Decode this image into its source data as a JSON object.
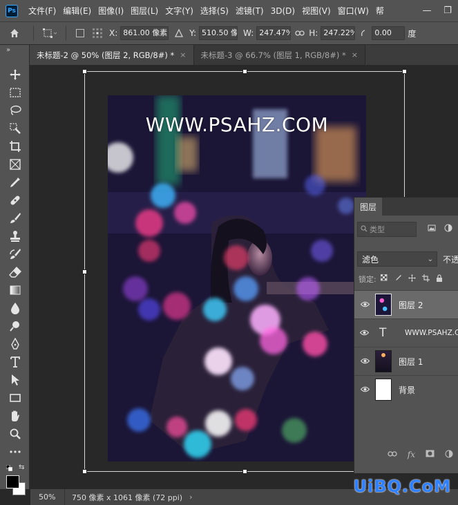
{
  "menubar": {
    "logo": "Ps",
    "items": [
      "文件(F)",
      "编辑(E)",
      "图像(I)",
      "图层(L)",
      "文字(Y)",
      "选择(S)",
      "滤镜(T)",
      "3D(D)",
      "视图(V)",
      "窗口(W)",
      "帮"
    ],
    "minimize": "—",
    "restore": "❐"
  },
  "options": {
    "x_label": "X:",
    "x_value": "861.00 像素",
    "y_label": "Y:",
    "y_value": "510.50 像",
    "w_label": "W:",
    "w_value": "247.47%",
    "h_label": "H:",
    "h_value": "247.22%",
    "angle_value": "0.00",
    "angle_unit": "度"
  },
  "tabs": [
    {
      "label": "未标题-2 @ 50% (图层 2, RGB/8#) *",
      "close": "×"
    },
    {
      "label": "未标题-3 @ 66.7% (图层 1, RGB/8#) *",
      "close": "×"
    }
  ],
  "toolbar": {
    "collapse": "»",
    "tools": [
      "move-tool",
      "marquee-tool",
      "lasso-tool",
      "quick-select-tool",
      "crop-tool",
      "frame-tool",
      "eyedropper-tool",
      "healing-tool",
      "brush-tool",
      "stamp-tool",
      "history-brush-tool",
      "eraser-tool",
      "gradient-tool",
      "blur-tool",
      "dodge-tool",
      "pen-tool",
      "type-tool",
      "path-select-tool",
      "rectangle-tool",
      "hand-tool",
      "zoom-tool",
      "more-tools"
    ],
    "fg_color": "#000000",
    "bg_color": "#ffffff"
  },
  "canvas": {
    "watermark": "WWW.PSAHZ.COM"
  },
  "layers": {
    "tab_label": "图层",
    "filter_placeholder": "类型",
    "blend_mode": "滤色",
    "opacity_label": "不透",
    "lock_label": "锁定:",
    "items": [
      {
        "name": "图层 2",
        "type": "image",
        "selected": true
      },
      {
        "name": "WWW.PSAHZ.C",
        "type": "text",
        "selected": false
      },
      {
        "name": "图层 1",
        "type": "image",
        "selected": false
      },
      {
        "name": "背景",
        "type": "background",
        "selected": false
      }
    ],
    "footer": [
      "link-icon",
      "fx-icon",
      "mask-icon",
      "adjustment-icon"
    ]
  },
  "status": {
    "zoom": "50%",
    "doc_info": "750 像素 x 1061 像素 (72 ppi)",
    "arrow": "›"
  },
  "site_logo": "UiBQ.CoM",
  "colors": {
    "ui_dark": "#535353",
    "canvas_bg": "#282828",
    "ps_blue": "#31a8ff"
  }
}
